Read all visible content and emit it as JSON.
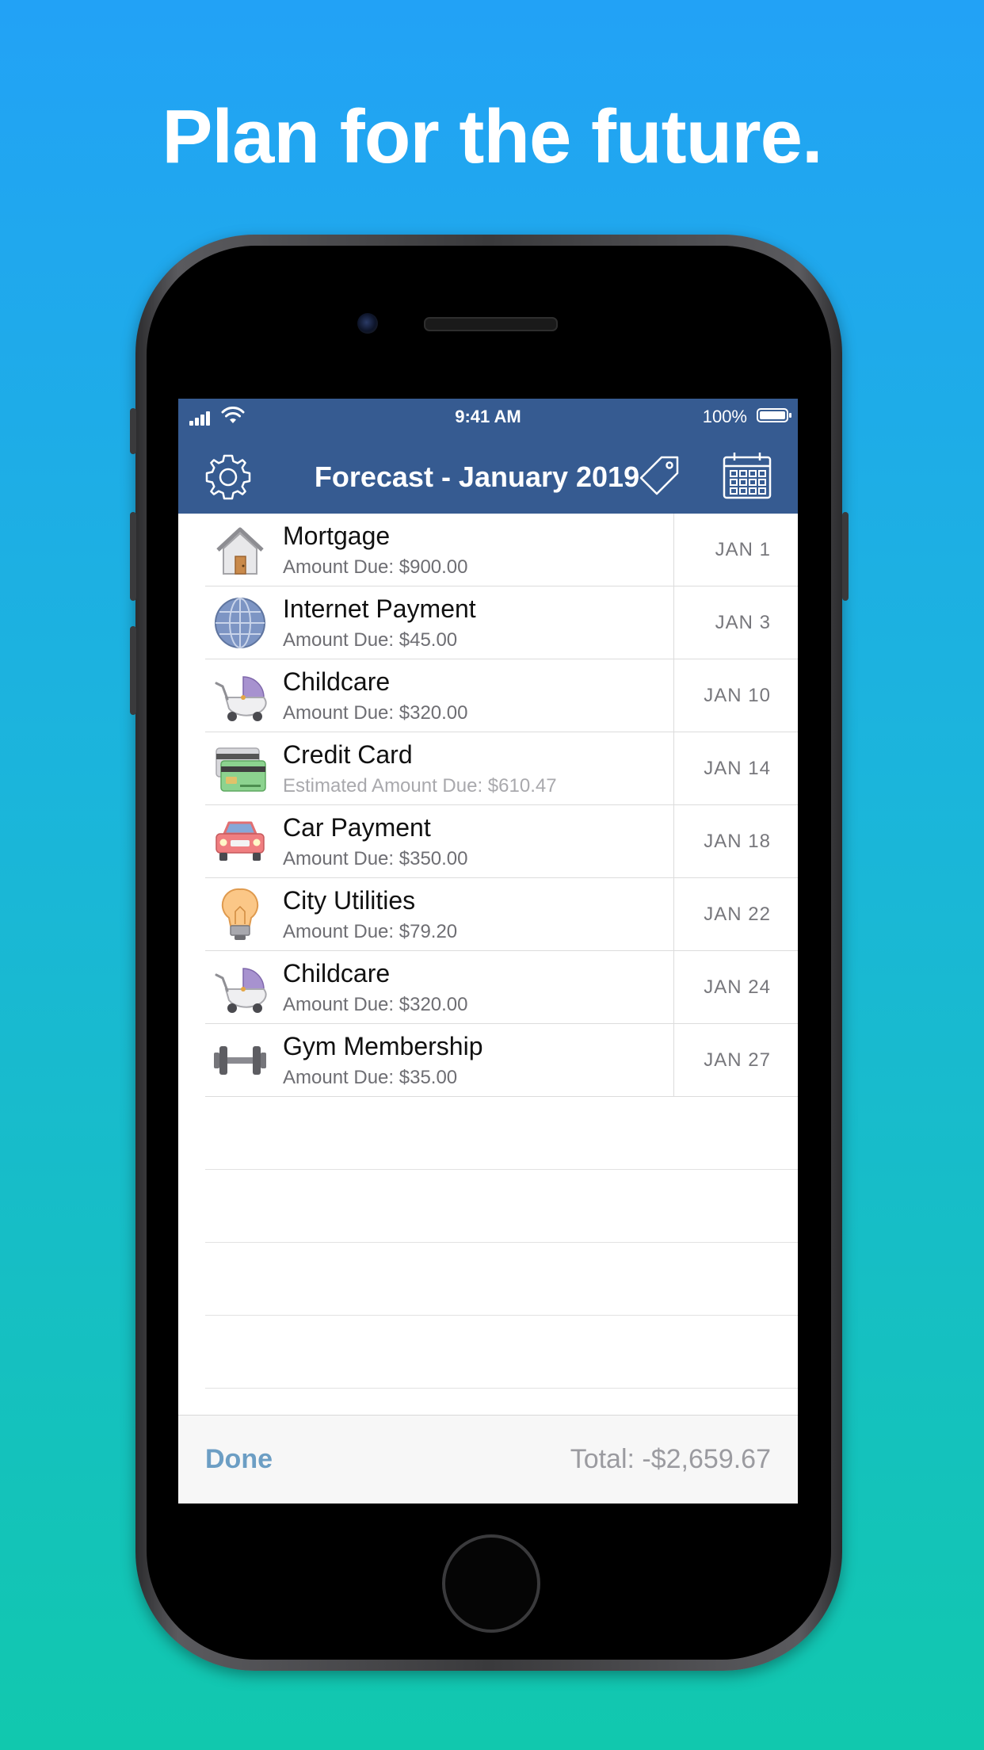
{
  "headline": "Plan for the future.",
  "status_bar": {
    "time": "9:41 AM",
    "battery": "100%"
  },
  "nav": {
    "title": "Forecast - January 2019"
  },
  "bills": [
    {
      "title": "Mortgage",
      "subtitle": "Amount Due: $900.00",
      "date": "JAN 1",
      "icon": "house-icon"
    },
    {
      "title": "Internet Payment",
      "subtitle": "Amount Due: $45.00",
      "date": "JAN 3",
      "icon": "globe-icon"
    },
    {
      "title": "Childcare",
      "subtitle": "Amount Due: $320.00",
      "date": "JAN 10",
      "icon": "stroller-icon"
    },
    {
      "title": "Credit Card",
      "subtitle": "Estimated Amount Due: $610.47",
      "date": "JAN 14",
      "icon": "credit-card-icon"
    },
    {
      "title": "Car Payment",
      "subtitle": "Amount Due: $350.00",
      "date": "JAN 18",
      "icon": "car-icon"
    },
    {
      "title": "City Utilities",
      "subtitle": "Amount Due: $79.20",
      "date": "JAN 22",
      "icon": "lightbulb-icon"
    },
    {
      "title": "Childcare",
      "subtitle": "Amount Due: $320.00",
      "date": "JAN 24",
      "icon": "stroller-icon"
    },
    {
      "title": "Gym Membership",
      "subtitle": "Amount Due: $35.00",
      "date": "JAN 27",
      "icon": "dumbbell-icon"
    }
  ],
  "toolbar": {
    "done_label": "Done",
    "total": "Total: -$2,659.67"
  },
  "colors": {
    "nav_bar": "#365b91",
    "done": "#6c9ec4",
    "background_top": "#22a2f6",
    "background_bottom": "#11c8ae"
  }
}
